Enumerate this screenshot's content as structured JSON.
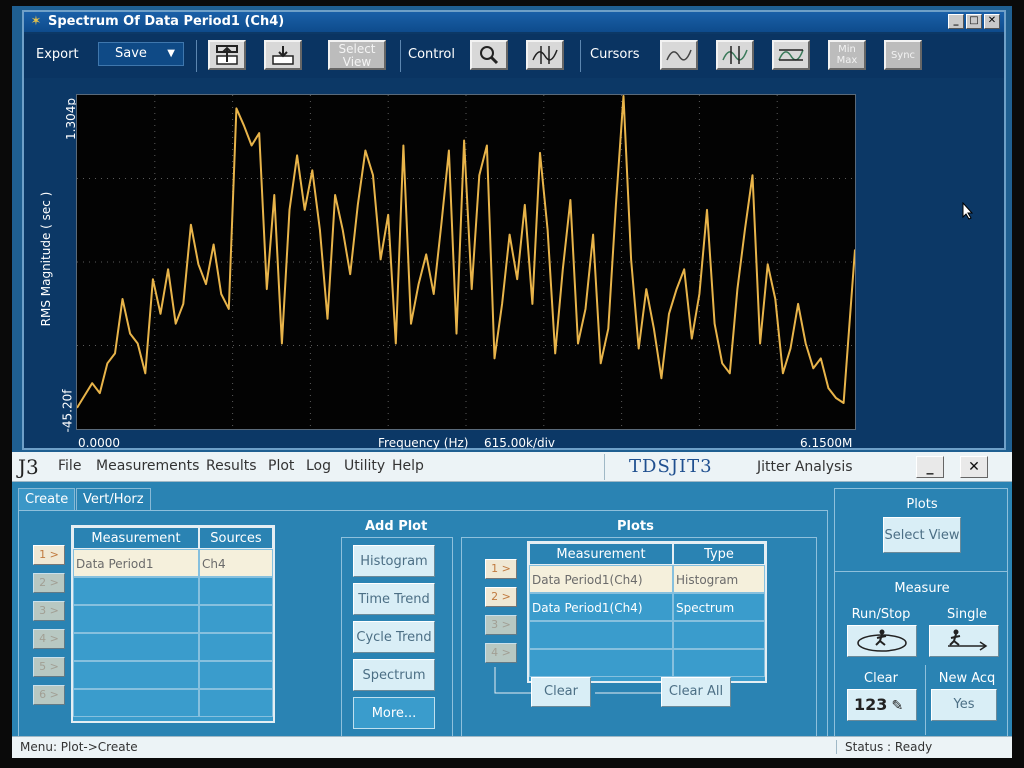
{
  "spectrum_window": {
    "title": "Spectrum Of Data Period1 (Ch4)",
    "window_controls": [
      "_",
      "□",
      "✕"
    ],
    "toolbar": {
      "export_label": "Export",
      "save_dropdown": {
        "value": "Save"
      },
      "select_view_label": "Select View",
      "control_label": "Control",
      "cursors_label": "Cursors",
      "min_max_label": "Min Max",
      "sync_label": "Sync"
    },
    "plot": {
      "y_axis_label": "RMS Magnitude ( sec )",
      "y_max_label": "1.304p",
      "y_min_label": "-45.20f",
      "x_min_label": "0.0000",
      "x_max_label": "6.1500M",
      "x_axis_caption": "Frequency (Hz)",
      "x_div_label": "615.00k/div",
      "trace_color": "#e8b44a",
      "grid_color": "#5a5a5a"
    }
  },
  "chart_data": {
    "type": "line",
    "title": "Spectrum Of Data Period1 (Ch4)",
    "xlabel": "Frequency (Hz)",
    "ylabel": "RMS Magnitude ( sec )",
    "xlim": [
      0,
      6150000
    ],
    "ylim": [
      -45.2,
      1304
    ],
    "y_unit": "fs",
    "series": [
      {
        "color": "#e8b44a",
        "x": [
          0,
          60000,
          120000,
          180000,
          240000,
          300000,
          360000,
          420000,
          480000,
          540000,
          600000,
          660000,
          720000,
          780000,
          840000,
          900000,
          960000,
          1020000,
          1080000,
          1140000,
          1200000,
          1260000,
          1320000,
          1380000,
          1440000,
          1500000,
          1560000,
          1620000,
          1680000,
          1740000,
          1800000,
          1860000,
          1920000,
          1980000,
          2040000,
          2100000,
          2160000,
          2220000,
          2280000,
          2340000,
          2400000,
          2460000,
          2520000,
          2580000,
          2640000,
          2700000,
          2760000,
          2820000,
          2880000,
          2940000,
          3000000,
          3060000,
          3120000,
          3180000,
          3240000,
          3300000,
          3360000,
          3420000,
          3480000,
          3540000,
          3600000,
          3660000,
          3720000,
          3780000,
          3840000,
          3900000,
          3960000,
          4020000,
          4080000,
          4140000,
          4200000,
          4260000,
          4320000,
          4380000,
          4440000,
          4500000,
          4560000,
          4620000,
          4680000,
          4740000,
          4800000,
          4860000,
          4920000,
          4980000,
          5040000,
          5100000,
          5160000,
          5220000,
          5280000,
          5340000,
          5400000,
          5460000,
          5520000,
          5580000,
          5640000,
          5700000,
          5760000,
          5820000,
          5880000,
          5940000,
          6000000,
          6060000,
          6150000
        ],
        "y": [
          40,
          90,
          140,
          100,
          220,
          260,
          480,
          340,
          300,
          180,
          560,
          420,
          600,
          380,
          460,
          780,
          620,
          540,
          700,
          500,
          440,
          1250,
          1180,
          1100,
          1150,
          520,
          900,
          300,
          840,
          1060,
          840,
          1000,
          760,
          400,
          900,
          760,
          580,
          860,
          1080,
          980,
          640,
          820,
          300,
          1100,
          380,
          540,
          660,
          500,
          780,
          1080,
          340,
          1120,
          520,
          980,
          1100,
          240,
          460,
          740,
          560,
          860,
          460,
          1070,
          760,
          260,
          600,
          880,
          300,
          440,
          740,
          220,
          360,
          860,
          1300,
          640,
          280,
          520,
          360,
          160,
          420,
          520,
          600,
          320,
          500,
          840,
          380,
          220,
          180,
          520,
          760,
          980,
          300,
          620,
          480,
          180,
          280,
          460,
          300,
          200,
          240,
          120,
          80,
          60,
          680
        ]
      }
    ]
  },
  "jitter_window": {
    "logo": "J3",
    "menu": [
      "File",
      "Measurements",
      "Results",
      "Plot",
      "Log",
      "Utility",
      "Help"
    ],
    "brand": "TDSJIT3",
    "brand_sub": "Jitter Analysis",
    "tabs": [
      "Create",
      "Vert/Horz Axis"
    ],
    "measurement_table": {
      "headers": [
        "Measurement",
        "Sources"
      ],
      "rows": [
        [
          "Data Period1",
          "Ch4"
        ],
        [
          "",
          ""
        ],
        [
          "",
          ""
        ],
        [
          "",
          ""
        ],
        [
          "",
          ""
        ],
        [
          "",
          ""
        ]
      ]
    },
    "row_buttons": [
      "1 >",
      "2 >",
      "3 >",
      "4 >",
      "5 >",
      "6 >"
    ],
    "add_plot": {
      "title": "Add Plot",
      "buttons": [
        "Histogram",
        "Time Trend",
        "Cycle Trend",
        "Spectrum",
        "More..."
      ]
    },
    "plots": {
      "title": "Plots",
      "headers": [
        "Measurement",
        "Type"
      ],
      "rows": [
        [
          "Data Period1(Ch4)",
          "Histogram"
        ],
        [
          "Data Period1(Ch4)",
          "Spectrum"
        ],
        [
          "",
          ""
        ],
        [
          "",
          ""
        ]
      ],
      "row_buttons": [
        "1 >",
        "2 >",
        "3 >",
        "4 >"
      ],
      "clear_label": "Clear",
      "clear_all_label": "Clear All"
    },
    "right_panel": {
      "plots_title": "Plots",
      "select_view_label": "Select View",
      "measure_title": "Measure",
      "run_stop_label": "Run/Stop",
      "single_label": "Single",
      "clear_label": "Clear",
      "new_acq_label": "New Acq",
      "yes_label": "Yes",
      "counter_text": "123"
    },
    "status": {
      "menu_path": "Menu: Plot->Create",
      "status_text": "Status : Ready"
    }
  }
}
